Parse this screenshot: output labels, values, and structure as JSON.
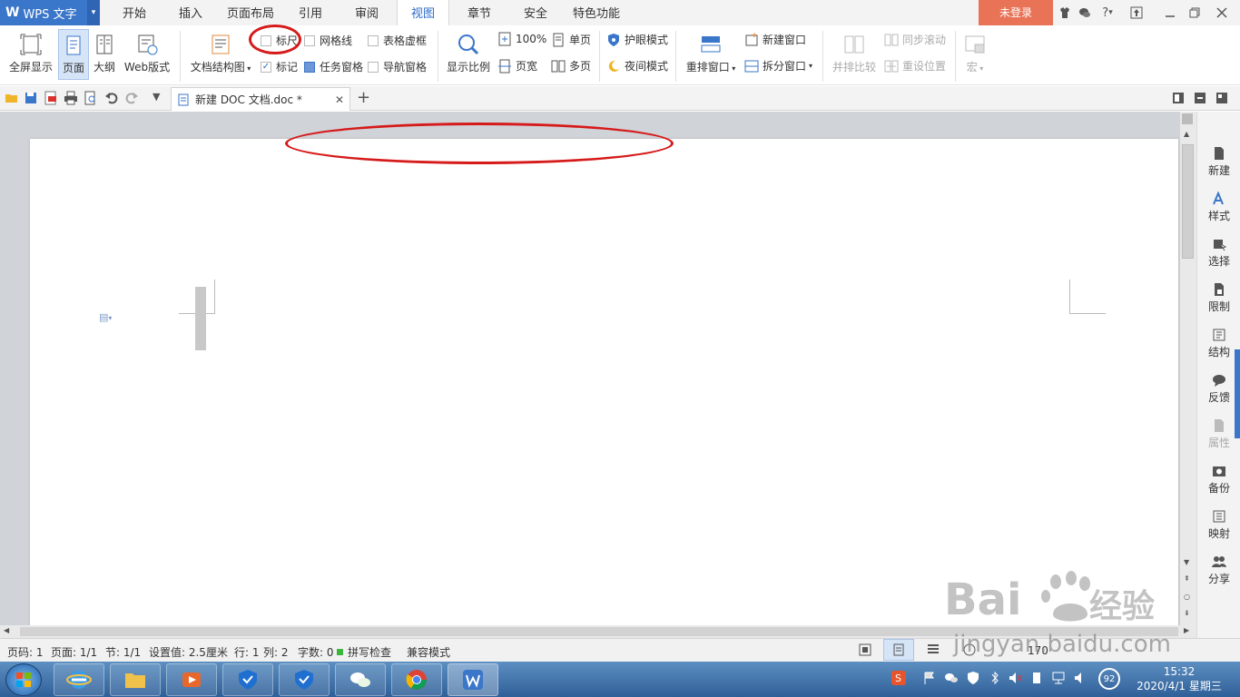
{
  "app": {
    "name": "WPS 文字",
    "logo": "W",
    "login_label": "未登录",
    "help_label": "?"
  },
  "menu": {
    "tabs": [
      {
        "label": "开始"
      },
      {
        "label": "插入"
      },
      {
        "label": "页面布局"
      },
      {
        "label": "引用"
      },
      {
        "label": "审阅"
      },
      {
        "label": "视图",
        "active": true
      },
      {
        "label": "章节"
      },
      {
        "label": "安全"
      },
      {
        "label": "特色功能"
      }
    ]
  },
  "ribbon": {
    "fullscreen": "全屏显示",
    "page_view": "页面",
    "outline": "大纲",
    "web_layout": "Web版式",
    "doc_structure": "文档结构图",
    "ruler": "标尺",
    "gridlines": "网格线",
    "table_gridlines": "表格虚框",
    "markup": "标记",
    "task_pane": "任务窗格",
    "nav_pane": "导航窗格",
    "zoom": "显示比例",
    "zoom_100": "100%",
    "page_width": "页宽",
    "single_page": "单页",
    "multi_page": "多页",
    "eye_protect": "护眼模式",
    "night_mode": "夜间模式",
    "arrange_windows": "重排窗口",
    "new_window": "新建窗口",
    "split_window": "拆分窗口",
    "side_by_side": "并排比较",
    "sync_scroll": "同步滚动",
    "reset_position": "重设位置",
    "macro": "宏"
  },
  "document": {
    "tab_title": "新建 DOC 文档.doc *"
  },
  "sidebar": {
    "items": [
      {
        "label": "新建",
        "icon": "new-doc-icon"
      },
      {
        "label": "样式",
        "icon": "style-icon"
      },
      {
        "label": "选择",
        "icon": "select-icon"
      },
      {
        "label": "限制",
        "icon": "restrict-icon"
      },
      {
        "label": "结构",
        "icon": "structure-icon"
      },
      {
        "label": "反馈",
        "icon": "feedback-icon"
      },
      {
        "label": "属性",
        "icon": "properties-icon",
        "disabled": true
      },
      {
        "label": "备份",
        "icon": "backup-icon"
      },
      {
        "label": "映射",
        "icon": "mapping-icon"
      },
      {
        "label": "分享",
        "icon": "share-icon"
      }
    ]
  },
  "status": {
    "page_num": "页码: 1",
    "pages": "页面: 1/1",
    "section": "节: 1/1",
    "setting": "设置值: 2.5厘米",
    "line": "行: 1",
    "col": "列: 2",
    "words": "字数: 0",
    "spell": "拼写检查",
    "compat": "兼容模式",
    "zoom": "170"
  },
  "taskbar": {
    "time": "15:32",
    "date": "2020/4/1 星期三",
    "battery": "92"
  },
  "watermark": {
    "brand": "Baidu经验",
    "url": "jingyan.baidu.com"
  },
  "colors": {
    "accent": "#3a76c9",
    "active_tab_text": "#2a6acb",
    "login": "#e87356",
    "annotation": "#d61a1a"
  }
}
